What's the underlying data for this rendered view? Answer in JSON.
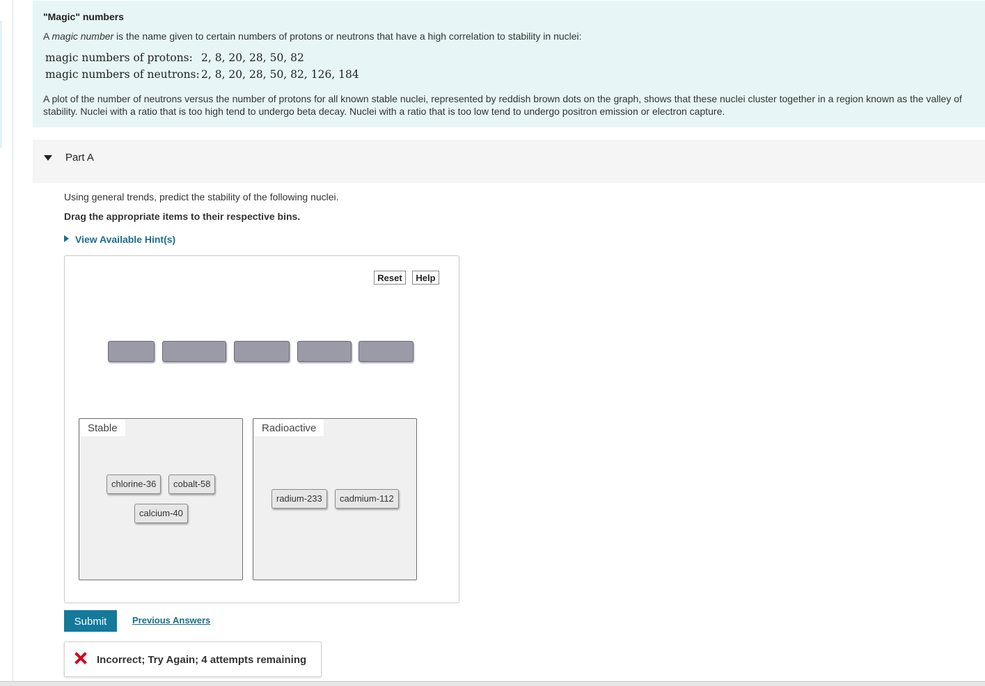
{
  "intro": {
    "title": "\"Magic\" numbers",
    "desc_prefix": "A ",
    "desc_term": "magic number",
    "desc_rest": " is the name given to certain numbers of protons or neutrons that have a high correlation to stability in nuclei:",
    "protons_label": "magic numbers of protons:",
    "protons_values": "2, 8, 20, 28, 50, 82",
    "neutrons_label": "magic numbers of neutrons:",
    "neutrons_values": "2, 8, 20, 28, 50, 82, 126, 184",
    "plot_text": "A plot of the number of neutrons versus the number of protons for all known stable nuclei, represented by reddish brown dots on the graph, shows that these nuclei cluster together in a region known as the valley of stability. Nuclei with a ratio that is too high tend to undergo beta decay. Nuclei with a ratio that is too low tend to undergo positron emission or electron capture."
  },
  "part": {
    "label": "Part A",
    "instruction": "Using general trends, predict the stability of the following nuclei.",
    "drag_instruction": "Drag the appropriate items to their respective bins.",
    "hints_label": "View Available Hint(s)"
  },
  "toolbar": {
    "reset_label": "Reset",
    "help_label": "Help"
  },
  "bins": {
    "stable": {
      "title": "Stable",
      "items": [
        "chlorine-36",
        "cobalt-58",
        "calcium-40"
      ]
    },
    "radioactive": {
      "title": "Radioactive",
      "items": [
        "radium-233",
        "cadmium-112"
      ]
    }
  },
  "actions": {
    "submit_label": "Submit",
    "previous_label": "Previous Answers"
  },
  "feedback": {
    "message": "Incorrect; Try Again; 4 attempts remaining",
    "icon": "x-icon",
    "icon_color": "#d0021b"
  },
  "colors": {
    "accent": "#137a9b",
    "link": "#1a6e8e",
    "intro_bg": "#e7f5f6",
    "slot": "#9b9ba8"
  }
}
